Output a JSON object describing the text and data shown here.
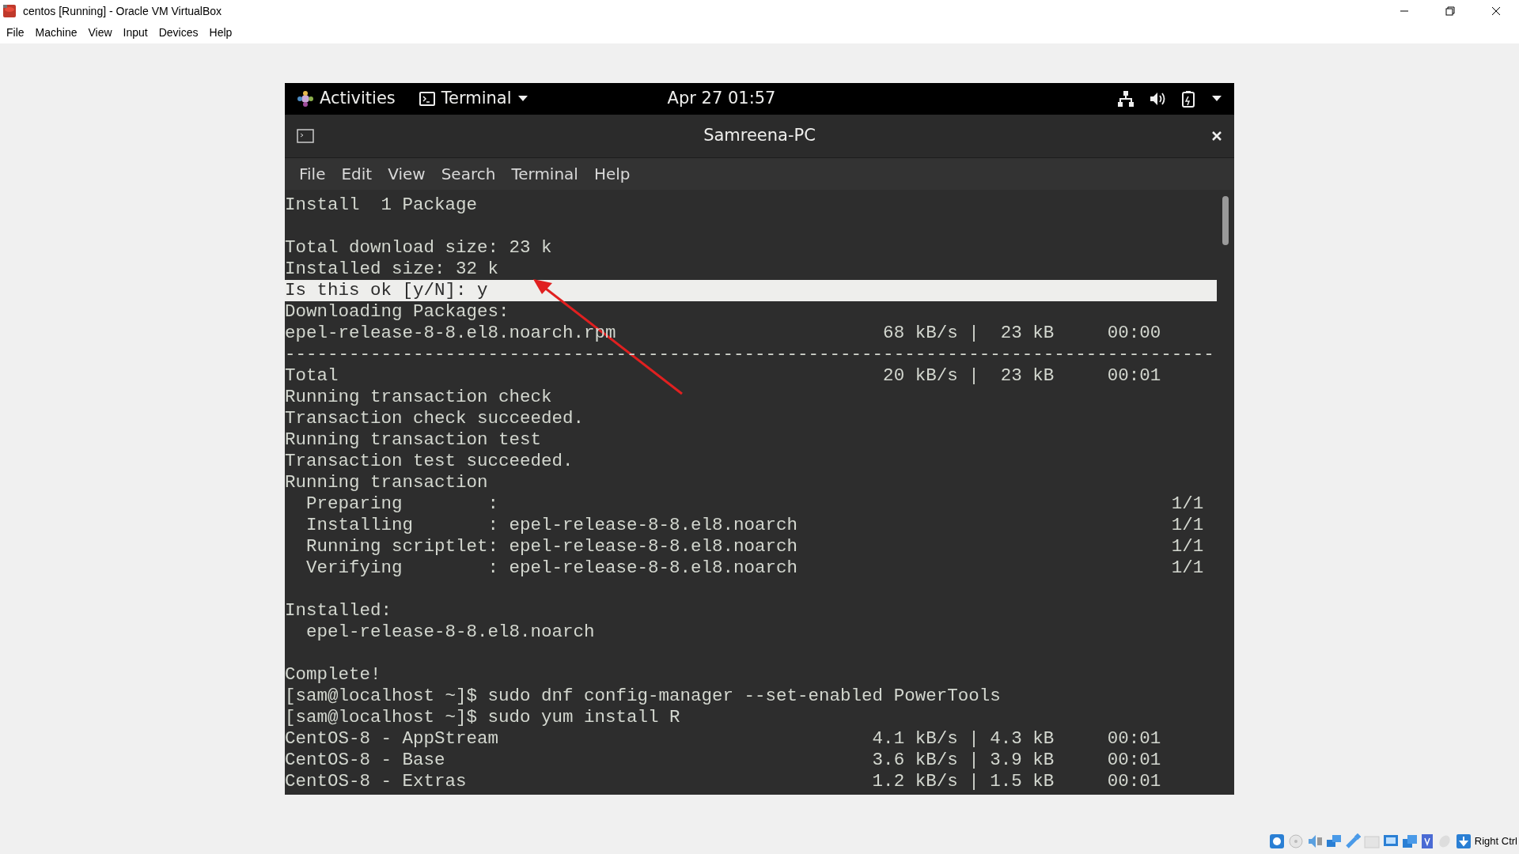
{
  "window": {
    "title": "centos [Running] - Oracle VM VirtualBox"
  },
  "menu": [
    "File",
    "Machine",
    "View",
    "Input",
    "Devices",
    "Help"
  ],
  "guest": {
    "top_bar": {
      "activities": "Activities",
      "app_menu": "Terminal",
      "clock": "Apr 27 01:57"
    },
    "terminal": {
      "title": "Samreena-PC",
      "menu": [
        "File",
        "Edit",
        "View",
        "Search",
        "Terminal",
        "Help"
      ],
      "lines": [
        {
          "kind": "text",
          "text": "Install  1 Package",
          "highlighted": false
        },
        {
          "kind": "blank"
        },
        {
          "kind": "text",
          "text": "Total download size: 23 k",
          "highlighted": false
        },
        {
          "kind": "text",
          "text": "Installed size: 32 k",
          "highlighted": false
        },
        {
          "kind": "text",
          "text": "Is this ok [y/N]: y",
          "highlighted": true
        },
        {
          "kind": "text",
          "text": "Downloading Packages:",
          "highlighted": false
        },
        {
          "kind": "text",
          "text": "epel-release-8-8.el8.noarch.rpm                         68 kB/s |  23 kB     00:00",
          "highlighted": false
        },
        {
          "kind": "text",
          "text": "---------------------------------------------------------------------------------------",
          "highlighted": false
        },
        {
          "kind": "text",
          "text": "Total                                                   20 kB/s |  23 kB     00:01",
          "highlighted": false
        },
        {
          "kind": "text",
          "text": "Running transaction check",
          "highlighted": false
        },
        {
          "kind": "text",
          "text": "Transaction check succeeded.",
          "highlighted": false
        },
        {
          "kind": "text",
          "text": "Running transaction test",
          "highlighted": false
        },
        {
          "kind": "text",
          "text": "Transaction test succeeded.",
          "highlighted": false
        },
        {
          "kind": "text",
          "text": "Running transaction",
          "highlighted": false
        },
        {
          "kind": "text",
          "text": "  Preparing        :                                                               1/1",
          "highlighted": false
        },
        {
          "kind": "text",
          "text": "  Installing       : epel-release-8-8.el8.noarch                                   1/1",
          "highlighted": false
        },
        {
          "kind": "text",
          "text": "  Running scriptlet: epel-release-8-8.el8.noarch                                   1/1",
          "highlighted": false
        },
        {
          "kind": "text",
          "text": "  Verifying        : epel-release-8-8.el8.noarch                                   1/1",
          "highlighted": false
        },
        {
          "kind": "blank"
        },
        {
          "kind": "text",
          "text": "Installed:",
          "highlighted": false
        },
        {
          "kind": "text",
          "text": "  epel-release-8-8.el8.noarch",
          "highlighted": false
        },
        {
          "kind": "blank"
        },
        {
          "kind": "text",
          "text": "Complete!",
          "highlighted": false
        },
        {
          "kind": "text",
          "text": "[sam@localhost ~]$ sudo dnf config-manager --set-enabled PowerTools",
          "highlighted": false
        },
        {
          "kind": "text",
          "text": "[sam@localhost ~]$ sudo yum install R",
          "highlighted": false
        },
        {
          "kind": "text",
          "text": "CentOS-8 - AppStream                                   4.1 kB/s | 4.3 kB     00:01",
          "highlighted": false
        },
        {
          "kind": "text",
          "text": "CentOS-8 - Base                                        3.6 kB/s | 3.9 kB     00:01",
          "highlighted": false
        },
        {
          "kind": "text",
          "text": "CentOS-8 - Extras                                      1.2 kB/s | 1.5 kB     00:01",
          "highlighted": false
        }
      ]
    }
  },
  "status_bar": {
    "host_key": "Right Ctrl"
  }
}
